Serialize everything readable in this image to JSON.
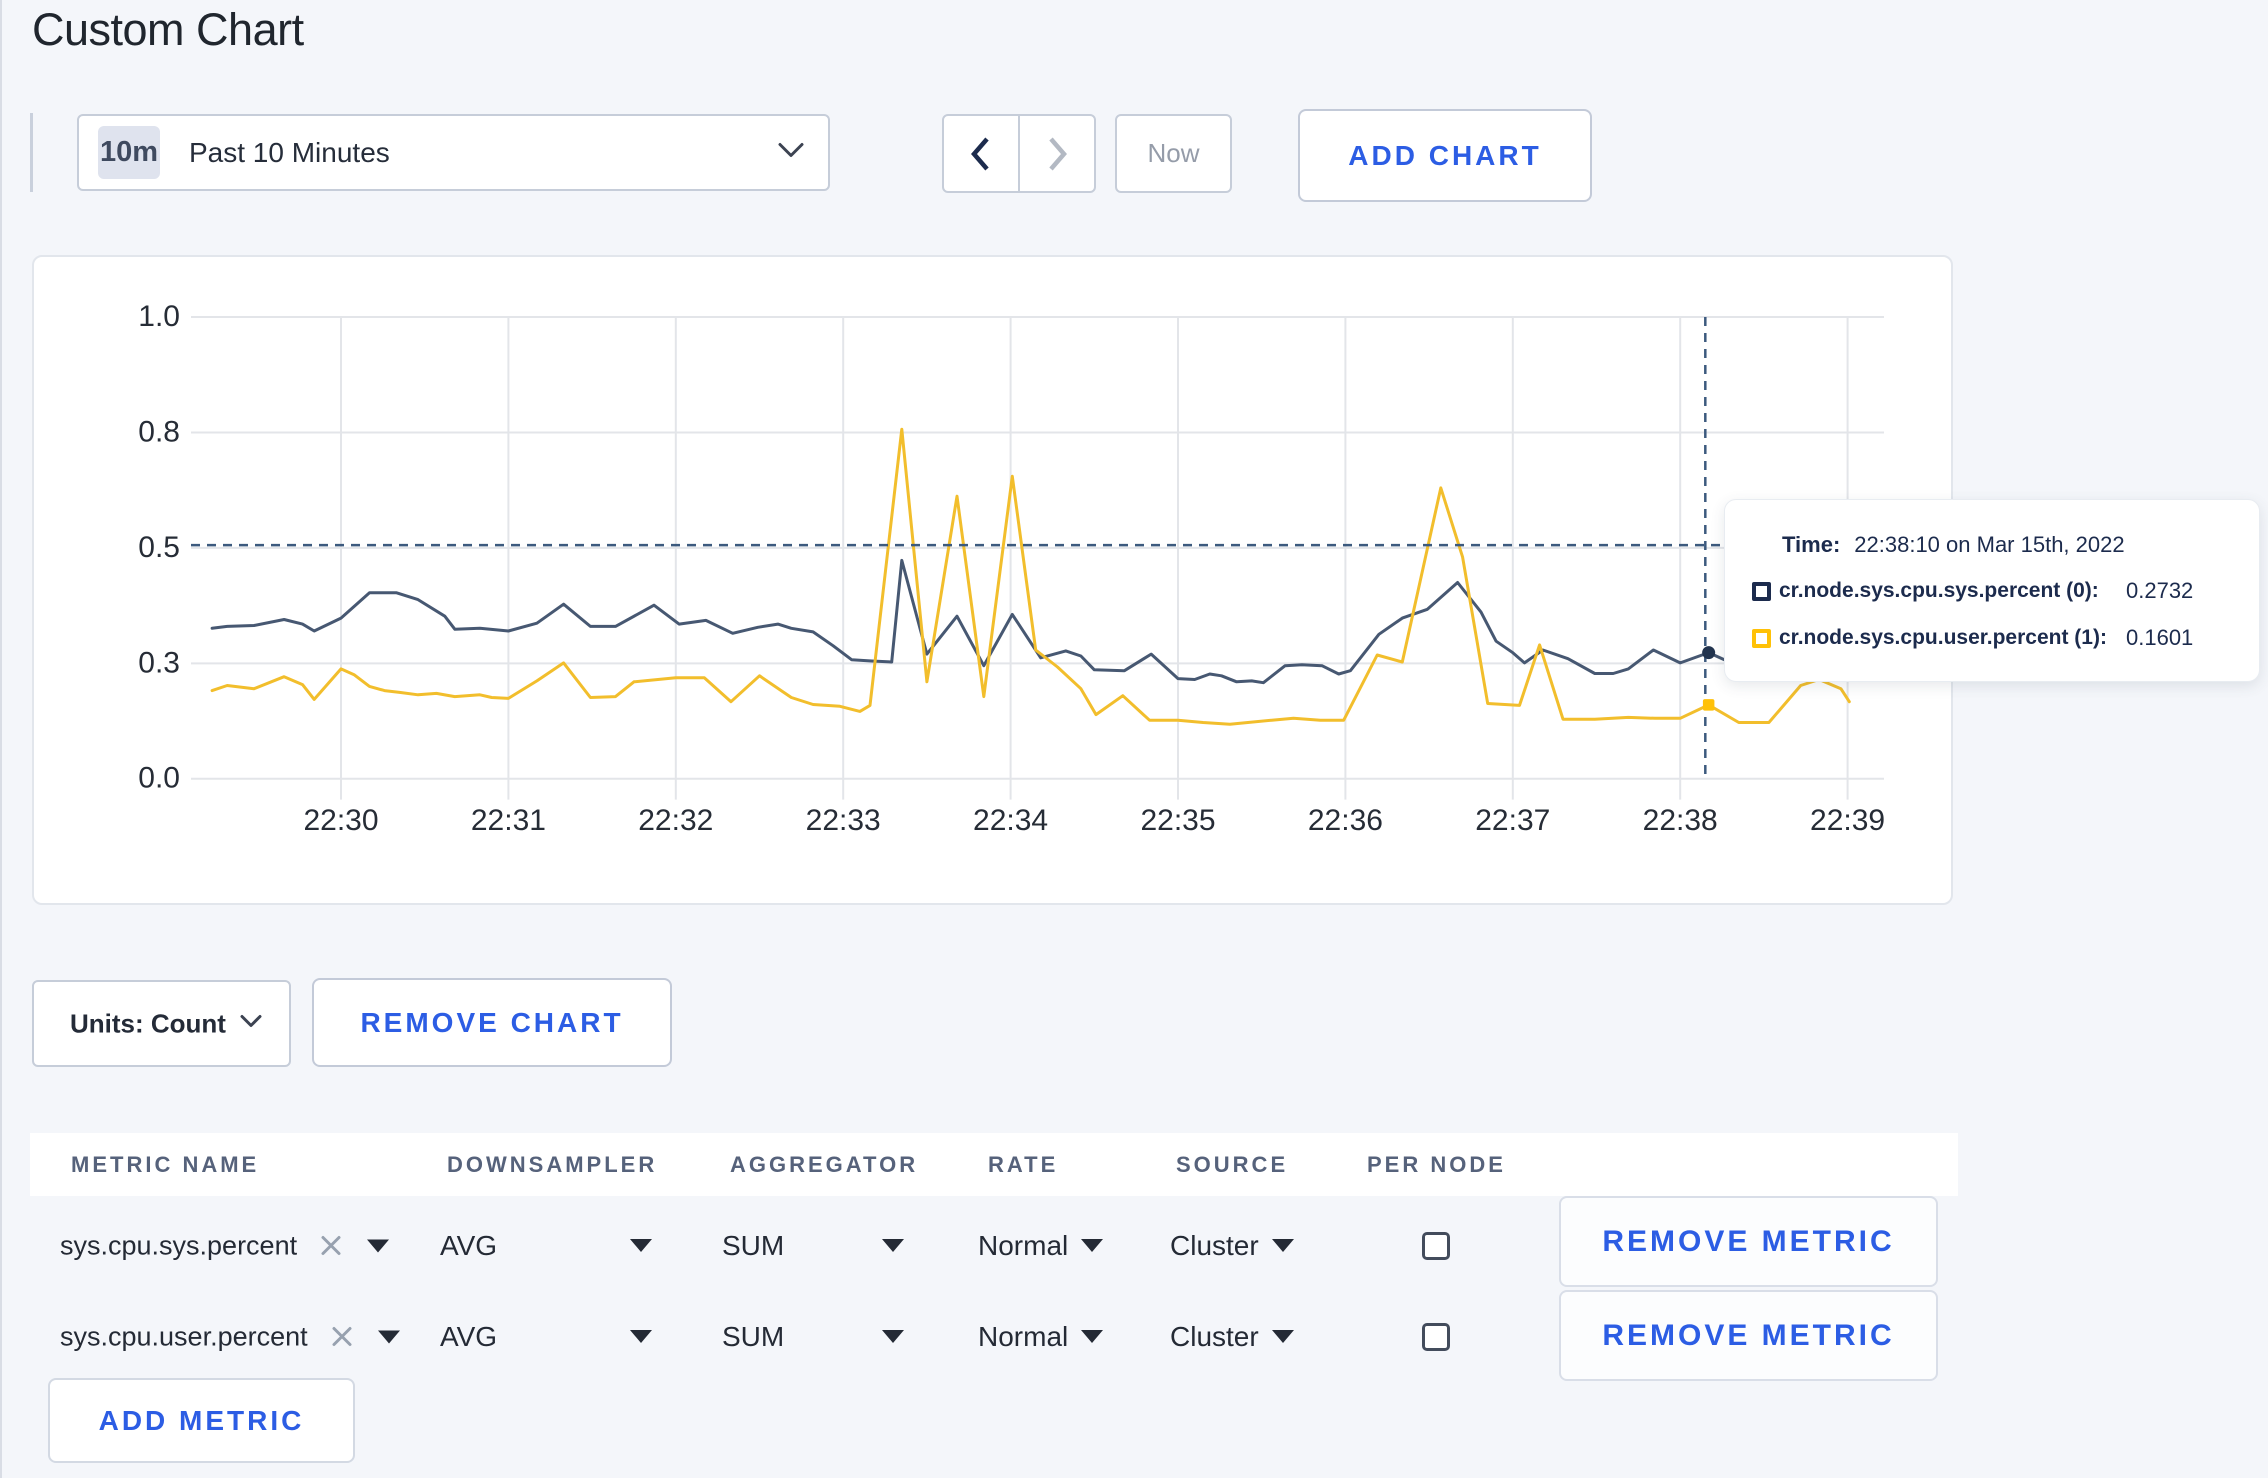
{
  "page": {
    "title": "Custom Chart"
  },
  "toolbar": {
    "time_badge": "10m",
    "time_label": "Past 10 Minutes",
    "prev_icon": "chevron-left-icon",
    "next_icon": "chevron-right-icon",
    "now_label": "Now",
    "add_chart_label": "ADD CHART"
  },
  "chart_data": {
    "type": "line",
    "title": "",
    "xlabel": "",
    "ylabel": "",
    "x_ticks": [
      "22:30",
      "22:31",
      "22:32",
      "22:33",
      "22:34",
      "22:35",
      "22:36",
      "22:37",
      "22:38",
      "22:39"
    ],
    "y_ticks": [
      "0.0",
      "0.3",
      "0.5",
      "0.8",
      "1.0"
    ],
    "ylim": [
      0,
      1
    ],
    "grid": true,
    "colors": {
      "grid": "#e3e5e9",
      "axis_text": "#262c36",
      "crosshair": "#3c5a7e"
    },
    "series": [
      {
        "name": "cr.node.sys.cpu.sys.percent (0)",
        "color": "#475872",
        "marker_color": "#22344f",
        "points": [
          [
            -0.77,
            0.326
          ],
          [
            -0.68,
            0.33
          ],
          [
            -0.52,
            0.332
          ],
          [
            -0.34,
            0.345
          ],
          [
            -0.23,
            0.335
          ],
          [
            -0.16,
            0.32
          ],
          [
            0.0,
            0.348
          ],
          [
            0.17,
            0.403
          ],
          [
            0.33,
            0.403
          ],
          [
            0.46,
            0.388
          ],
          [
            0.62,
            0.352
          ],
          [
            0.68,
            0.324
          ],
          [
            0.83,
            0.326
          ],
          [
            1.0,
            0.32
          ],
          [
            1.17,
            0.337
          ],
          [
            1.33,
            0.378
          ],
          [
            1.49,
            0.33
          ],
          [
            1.64,
            0.33
          ],
          [
            1.87,
            0.376
          ],
          [
            2.02,
            0.335
          ],
          [
            2.18,
            0.343
          ],
          [
            2.34,
            0.315
          ],
          [
            2.49,
            0.328
          ],
          [
            2.61,
            0.335
          ],
          [
            2.69,
            0.326
          ],
          [
            2.82,
            0.318
          ],
          [
            2.94,
            0.288
          ],
          [
            3.05,
            0.258
          ],
          [
            3.17,
            0.255
          ],
          [
            3.29,
            0.253
          ],
          [
            3.35,
            0.473
          ],
          [
            3.5,
            0.27
          ],
          [
            3.68,
            0.352
          ],
          [
            3.84,
            0.245
          ],
          [
            4.01,
            0.356
          ],
          [
            4.18,
            0.262
          ],
          [
            4.33,
            0.277
          ],
          [
            4.42,
            0.266
          ],
          [
            4.5,
            0.236
          ],
          [
            4.68,
            0.234
          ],
          [
            4.84,
            0.27
          ],
          [
            5.0,
            0.217
          ],
          [
            5.1,
            0.215
          ],
          [
            5.19,
            0.227
          ],
          [
            5.26,
            0.223
          ],
          [
            5.35,
            0.21
          ],
          [
            5.44,
            0.212
          ],
          [
            5.51,
            0.208
          ],
          [
            5.64,
            0.245
          ],
          [
            5.74,
            0.247
          ],
          [
            5.86,
            0.245
          ],
          [
            5.96,
            0.227
          ],
          [
            6.03,
            0.234
          ],
          [
            6.2,
            0.313
          ],
          [
            6.34,
            0.348
          ],
          [
            6.49,
            0.367
          ],
          [
            6.67,
            0.425
          ],
          [
            6.81,
            0.361
          ],
          [
            6.9,
            0.298
          ],
          [
            7.0,
            0.273
          ],
          [
            7.07,
            0.251
          ],
          [
            7.18,
            0.279
          ],
          [
            7.33,
            0.26
          ],
          [
            7.49,
            0.228
          ],
          [
            7.6,
            0.228
          ],
          [
            7.69,
            0.238
          ],
          [
            7.84,
            0.279
          ],
          [
            8.0,
            0.251
          ],
          [
            8.17,
            0.2732
          ],
          [
            8.28,
            0.255
          ]
        ]
      },
      {
        "name": "cr.node.sys.cpu.user.percent (1)",
        "color": "#f2be2c",
        "marker_color": "#ffc107",
        "points": [
          [
            -0.77,
            0.191
          ],
          [
            -0.68,
            0.202
          ],
          [
            -0.52,
            0.195
          ],
          [
            -0.34,
            0.221
          ],
          [
            -0.23,
            0.204
          ],
          [
            -0.16,
            0.172
          ],
          [
            0.0,
            0.238
          ],
          [
            0.08,
            0.225
          ],
          [
            0.17,
            0.2
          ],
          [
            0.26,
            0.191
          ],
          [
            0.35,
            0.187
          ],
          [
            0.46,
            0.182
          ],
          [
            0.57,
            0.185
          ],
          [
            0.68,
            0.178
          ],
          [
            0.83,
            0.182
          ],
          [
            0.9,
            0.176
          ],
          [
            1.0,
            0.174
          ],
          [
            1.17,
            0.212
          ],
          [
            1.33,
            0.251
          ],
          [
            1.49,
            0.176
          ],
          [
            1.64,
            0.178
          ],
          [
            1.75,
            0.21
          ],
          [
            2.0,
            0.219
          ],
          [
            2.17,
            0.219
          ],
          [
            2.33,
            0.167
          ],
          [
            2.5,
            0.223
          ],
          [
            2.69,
            0.176
          ],
          [
            2.82,
            0.161
          ],
          [
            2.98,
            0.157
          ],
          [
            3.1,
            0.146
          ],
          [
            3.16,
            0.159
          ],
          [
            3.35,
            0.757
          ],
          [
            3.5,
            0.21
          ],
          [
            3.68,
            0.612
          ],
          [
            3.84,
            0.178
          ],
          [
            4.01,
            0.655
          ],
          [
            4.15,
            0.279
          ],
          [
            4.28,
            0.242
          ],
          [
            4.42,
            0.195
          ],
          [
            4.51,
            0.139
          ],
          [
            4.67,
            0.18
          ],
          [
            4.83,
            0.127
          ],
          [
            5.0,
            0.127
          ],
          [
            5.15,
            0.122
          ],
          [
            5.31,
            0.118
          ],
          [
            5.56,
            0.127
          ],
          [
            5.69,
            0.131
          ],
          [
            5.85,
            0.127
          ],
          [
            5.99,
            0.127
          ],
          [
            6.19,
            0.268
          ],
          [
            6.34,
            0.253
          ],
          [
            6.57,
            0.63
          ],
          [
            6.7,
            0.48
          ],
          [
            6.85,
            0.163
          ],
          [
            7.04,
            0.159
          ],
          [
            7.16,
            0.29
          ],
          [
            7.3,
            0.129
          ],
          [
            7.49,
            0.129
          ],
          [
            7.69,
            0.133
          ],
          [
            7.85,
            0.131
          ],
          [
            8.0,
            0.131
          ],
          [
            8.17,
            0.1601
          ],
          [
            8.35,
            0.122
          ],
          [
            8.53,
            0.122
          ],
          [
            8.72,
            0.202
          ],
          [
            8.83,
            0.215
          ],
          [
            8.96,
            0.195
          ],
          [
            9.01,
            0.167
          ]
        ]
      }
    ],
    "hover": {
      "t": 8.15,
      "crosshair_y_value": 0.506,
      "time_label": "Time:",
      "time_value": "22:38:10 on Mar 15th, 2022",
      "rows": [
        {
          "label": "cr.node.sys.cpu.sys.percent (0):",
          "value": "0.2732"
        },
        {
          "label": "cr.node.sys.cpu.user.percent (1):",
          "value": "0.1601"
        }
      ]
    }
  },
  "units": {
    "label": "Units: Count",
    "remove_chart_label": "REMOVE CHART"
  },
  "metrics_table": {
    "headers": [
      "METRIC NAME",
      "DOWNSAMPLER",
      "AGGREGATOR",
      "RATE",
      "SOURCE",
      "PER NODE"
    ],
    "rows": [
      {
        "metric": "sys.cpu.sys.percent",
        "downsampler": "AVG",
        "aggregator": "SUM",
        "rate": "Normal",
        "source": "Cluster",
        "per_node_checked": false,
        "remove_label": "REMOVE METRIC"
      },
      {
        "metric": "sys.cpu.user.percent",
        "downsampler": "AVG",
        "aggregator": "SUM",
        "rate": "Normal",
        "source": "Cluster",
        "per_node_checked": false,
        "remove_label": "REMOVE METRIC"
      }
    ],
    "add_metric_label": "ADD METRIC"
  }
}
